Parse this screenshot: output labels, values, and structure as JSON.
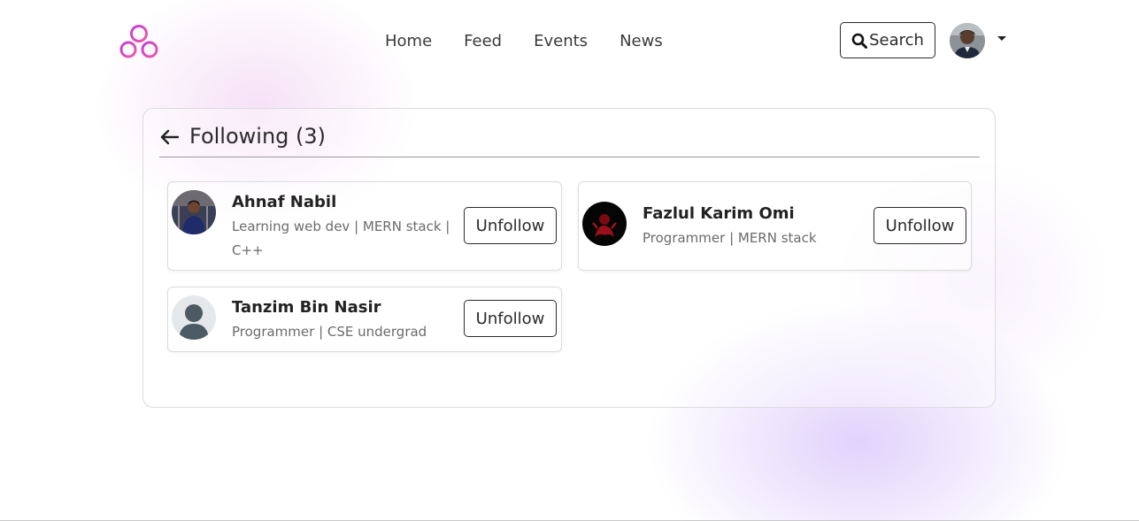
{
  "nav": {
    "logo_icon": "three-circles-logo-icon",
    "links": [
      "Home",
      "Feed",
      "Events",
      "News"
    ],
    "search_label": "Search",
    "search_icon": "search-icon",
    "profile_menu_icon": "caret-down-icon"
  },
  "colors": {
    "logo_gradient_start": "#c23fd6",
    "logo_gradient_end": "#ef5aa8",
    "accent_blob": "#d7c3fa"
  },
  "following": {
    "title": "Following (3)",
    "back_icon": "arrow-left-icon",
    "unfollow_label": "Unfollow",
    "people": [
      {
        "name": "Ahnaf Nabil",
        "bio": "Learning web dev | MERN stack | C++"
      },
      {
        "name": "Fazlul Karim Omi",
        "bio": "Programmer | MERN stack"
      },
      {
        "name": "Tanzim Bin Nasir",
        "bio": "Programmer | CSE undergrad"
      }
    ]
  }
}
